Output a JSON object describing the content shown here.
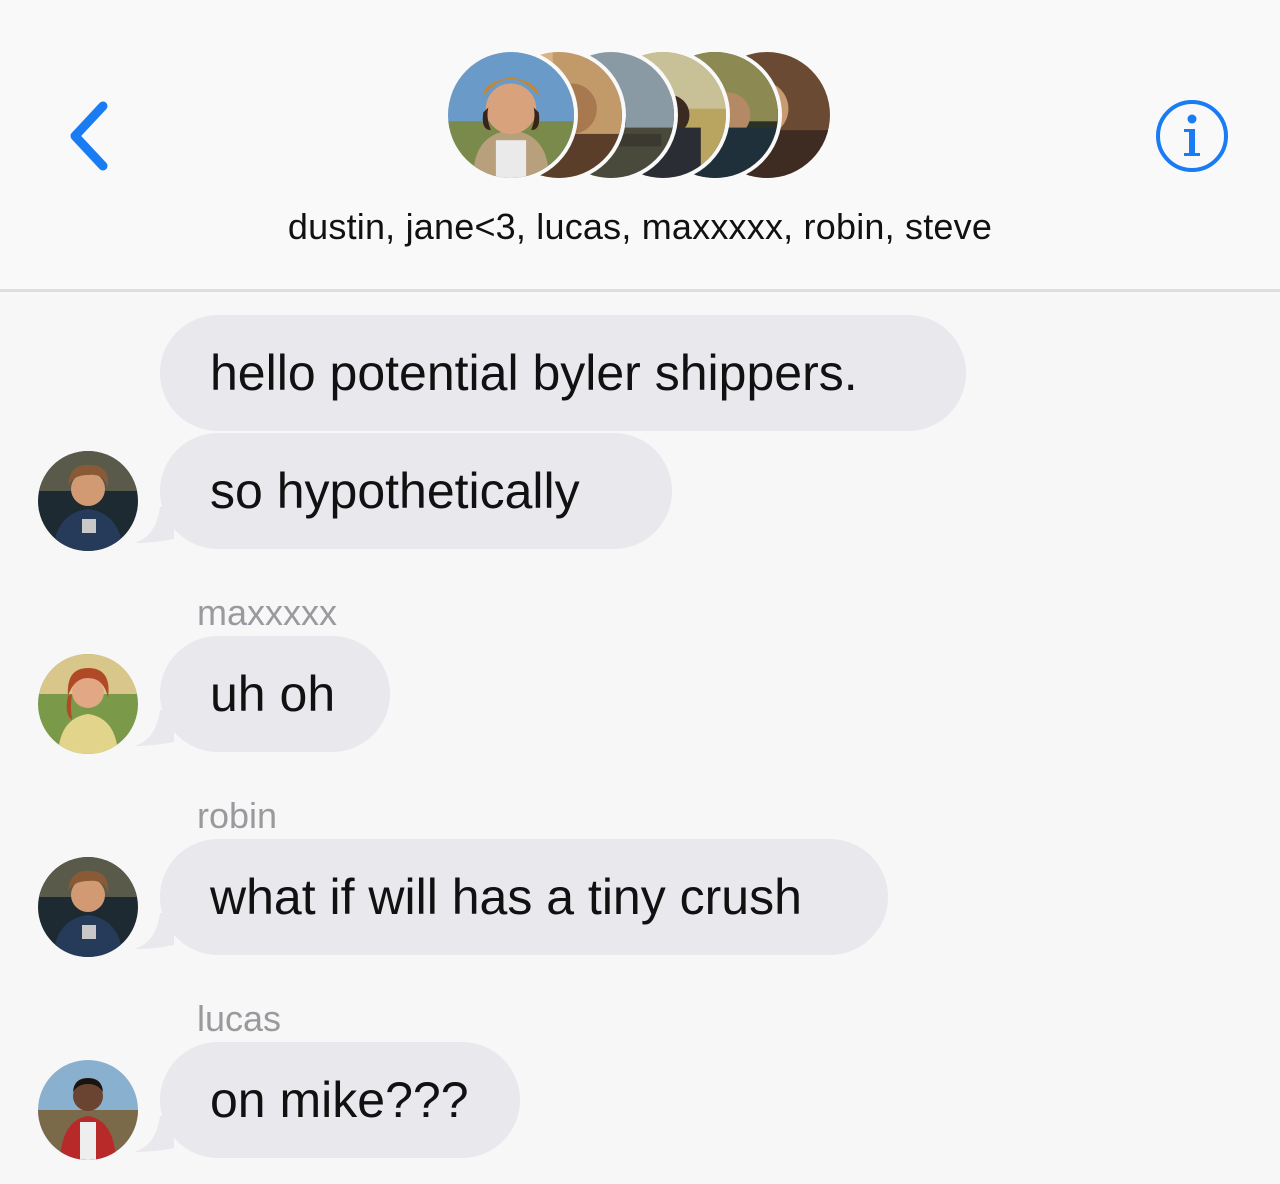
{
  "header": {
    "group_names": "dustin, jane<3, lucas, maxxxxx, robin, steve",
    "back_icon": "chevron-left-icon",
    "info_icon": "info-circle-icon",
    "accent_color": "#1a7cf2"
  },
  "messages": [
    {
      "sender": "",
      "text": "hello potential byler shippers.",
      "show_avatar": false
    },
    {
      "sender": "",
      "text": "so hypothetically",
      "show_avatar": true
    },
    {
      "sender": "maxxxxx",
      "text": "uh oh",
      "show_avatar": true
    },
    {
      "sender": "robin",
      "text": "what if will has a tiny crush",
      "show_avatar": true
    },
    {
      "sender": "lucas",
      "text": "on mike???",
      "show_avatar": true
    }
  ]
}
